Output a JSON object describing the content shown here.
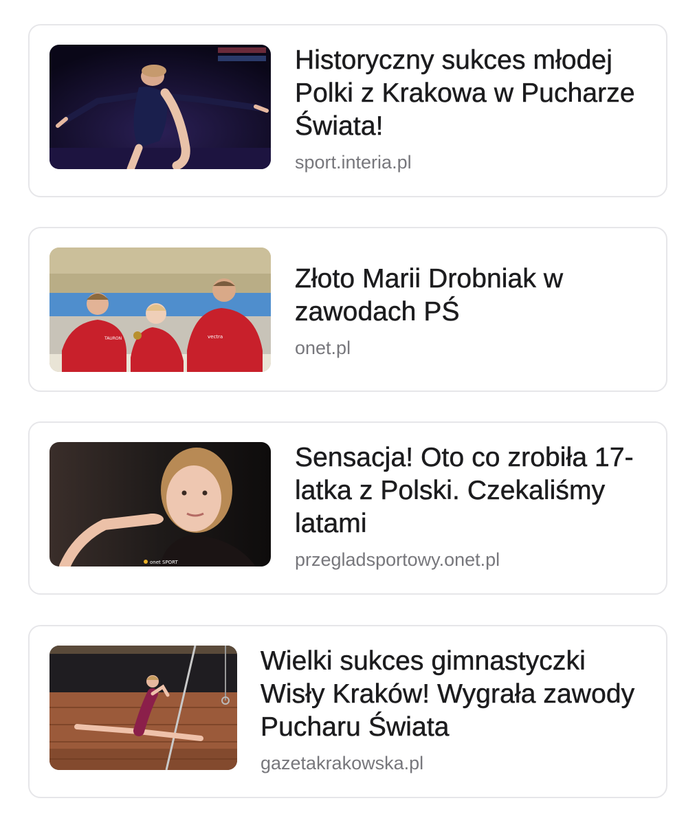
{
  "articles": [
    {
      "headline": "Historyczny sukces młodej Polki z Krakowa w Pucharze Świata!",
      "source": "sport.interia.pl",
      "image": "gymnast-balance-beam-photo"
    },
    {
      "headline": "Złoto Marii Drobniak w zawodach PŚ",
      "source": "onet.pl",
      "image": "team-poland-medal-photo"
    },
    {
      "headline": "Sensacja! Oto co zrobiła 17-latka z Polski. Czekaliśmy latami",
      "source": "przegladsportowy.onet.pl",
      "image": "gymnast-salute-portrait-photo",
      "image_watermark": "onet SPORT"
    },
    {
      "headline": "Wielki sukces gimnastyczki Wisły Kraków! Wygrała zawody Pucharu Świata",
      "source": "gazetakrakowska.pl",
      "image": "gymnast-uneven-bars-photo"
    }
  ]
}
